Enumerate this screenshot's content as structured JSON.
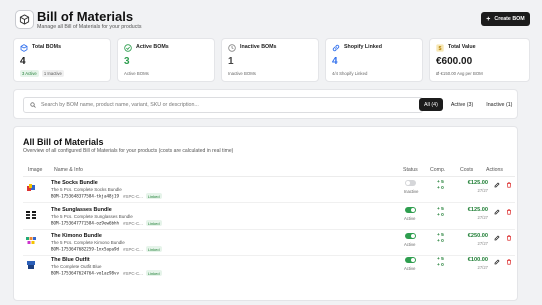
{
  "header": {
    "title": "Bill of Materials",
    "subtitle": "Manage all Bill of Materials for your products",
    "create_label": "Create BOM",
    "create_icon": "plus-icon"
  },
  "stats": [
    {
      "label": "Total BOMs",
      "value": "4",
      "badges": [
        "3 Active",
        "1 Inactive"
      ],
      "sub": "",
      "icon": "cube-icon",
      "color": "#2f6fed"
    },
    {
      "label": "Active BOMs",
      "value": "3",
      "sub": "Active BOMs",
      "icon": "check-circle-icon",
      "color": "#2e9e4f"
    },
    {
      "label": "Inactive BOMs",
      "value": "1",
      "sub": "Inactive BOMs",
      "icon": "clock-icon",
      "color": "#888888"
    },
    {
      "label": "Shopify Linked",
      "value": "4",
      "sub": "4/4 Shopify Linked",
      "icon": "link-icon",
      "color": "#2f6fed"
    },
    {
      "label": "Total Value",
      "value": "€600.00",
      "sub": "Ø €150.00 Avg per BOM",
      "icon": "dollar-icon",
      "color": "#d9a520"
    }
  ],
  "search": {
    "placeholder": "Search by BOM name, product name, variant, SKU or description...",
    "value": ""
  },
  "filters": [
    {
      "label": "All (4)",
      "active": true
    },
    {
      "label": "Active (3)",
      "active": false
    },
    {
      "label": "Inactive (1)",
      "active": false
    }
  ],
  "panel": {
    "title": "All Bill of Materials",
    "description": "Overview of all configured Bill of Materials for your products (costs are calculated in real time)"
  },
  "columns": {
    "image": "Image",
    "name": "Name & Info",
    "status": "Status",
    "comp": "Comp.",
    "costs": "Costs",
    "actions": "Actions"
  },
  "rows": [
    {
      "name": "The Socks Bundle",
      "desc": "The 5 Pcs. Complete Socks Bundle",
      "code": "BOM-1753648377584-tkja48j19",
      "sku": "#SPC-C...",
      "linked": "Linked",
      "active": false,
      "status": "Inactive",
      "comp_a": "+ 5",
      "comp_b": "+ 0",
      "cost": "€125.00",
      "cost_sub": "27/27"
    },
    {
      "name": "The Sunglasses Bundle",
      "desc": "The 5 Pcs. Complete Sunglasses Bundle",
      "code": "BOM-1753647771584-oz9ew6bhh",
      "sku": "#SPC-C...",
      "linked": "Linked",
      "active": true,
      "status": "Active",
      "comp_a": "+ 5",
      "comp_b": "+ 0",
      "cost": "€125.00",
      "cost_sub": "27/27"
    },
    {
      "name": "The Kimono Bundle",
      "desc": "The 5 Pcs. Complete Kimono Bundle",
      "code": "BOM-1753647682259-1nx5apa9d",
      "sku": "#SPC-C...",
      "linked": "Linked",
      "active": true,
      "status": "Active",
      "comp_a": "+ 5",
      "comp_b": "+ 0",
      "cost": "€250.00",
      "cost_sub": "27/27"
    },
    {
      "name": "The Blue Outfit",
      "desc": "The Complete Outfit Blue",
      "code": "BOM-1753647624764-vo1az98vv",
      "sku": "#SPC-C...",
      "linked": "Linked",
      "active": true,
      "status": "Active",
      "comp_a": "+ 5",
      "comp_b": "+ 0",
      "cost": "€100.00",
      "cost_sub": "27/27"
    }
  ]
}
